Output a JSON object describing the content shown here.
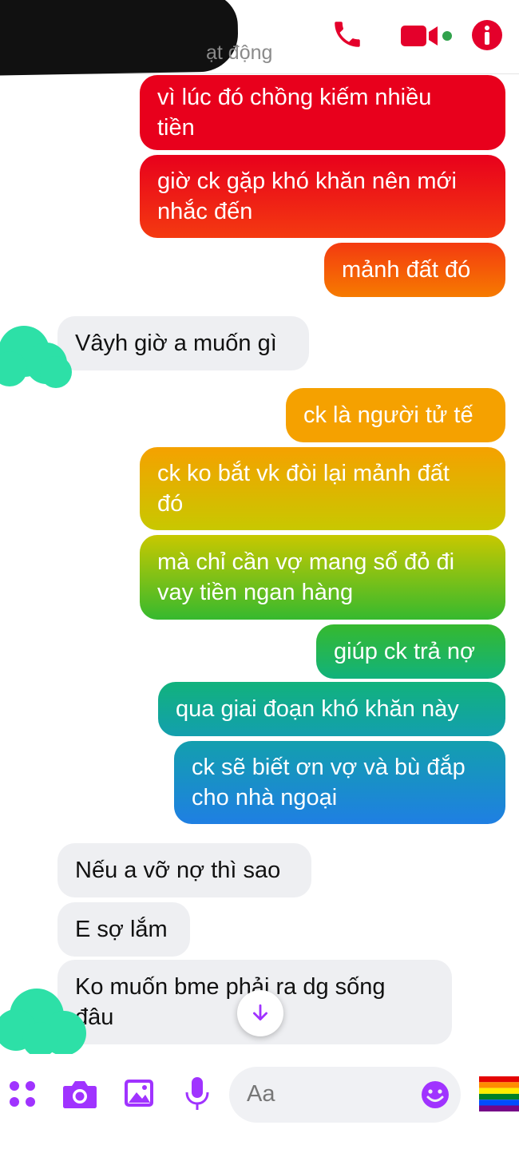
{
  "header": {
    "status_text": "ạt động",
    "icons": [
      "phone-icon",
      "video-camera-icon",
      "info-icon"
    ],
    "accent_color": "#e4002b"
  },
  "messages": [
    {
      "side": "sent",
      "lines": [
        "vì lúc đó chồng kiếm nhiều",
        "tiền"
      ]
    },
    {
      "side": "sent",
      "lines": [
        "giờ ck gặp khó khăn nên mới",
        "nhắc đến"
      ]
    },
    {
      "side": "sent",
      "lines": [
        "mảnh đất đó"
      ]
    },
    {
      "side": "received",
      "lines": [
        "Vâyh giờ a muốn gì"
      ]
    },
    {
      "side": "sent",
      "lines": [
        "ck là người tử tế"
      ]
    },
    {
      "side": "sent",
      "lines": [
        "ck ko bắt vk đòi lại mảnh đất",
        "đó"
      ]
    },
    {
      "side": "sent",
      "lines": [
        "mà chỉ cần vợ mang sổ đỏ đi",
        "vay tiền ngan hàng"
      ]
    },
    {
      "side": "sent",
      "lines": [
        "giúp ck trả nợ"
      ]
    },
    {
      "side": "sent",
      "lines": [
        "qua giai đoạn khó khăn này"
      ]
    },
    {
      "side": "sent",
      "lines": [
        "ck sẽ biết ơn vợ và bù đắp",
        "cho nhà ngoại"
      ]
    },
    {
      "side": "received",
      "lines": [
        "Nếu a vỡ nợ thì sao"
      ]
    },
    {
      "side": "received",
      "lines": [
        "E sợ lắm"
      ]
    },
    {
      "side": "received",
      "lines": [
        "Ko muốn bme phải ra dg sống",
        "đâu"
      ]
    }
  ],
  "composer": {
    "placeholder": "Aa",
    "icons": [
      "apps-icon",
      "camera-icon",
      "image-icon",
      "microphone-icon",
      "emoji-icon",
      "rainbow-flag-icon"
    ],
    "accent_color": "#a033ff"
  },
  "colors": {
    "bubble_gradient": [
      "#e8001c",
      "#f43a10",
      "#f67b00",
      "#f5a100",
      "#c8c800",
      "#36b92e",
      "#11b27c",
      "#139fae",
      "#1f7fe3"
    ],
    "received_bg": "#eeeff2"
  }
}
